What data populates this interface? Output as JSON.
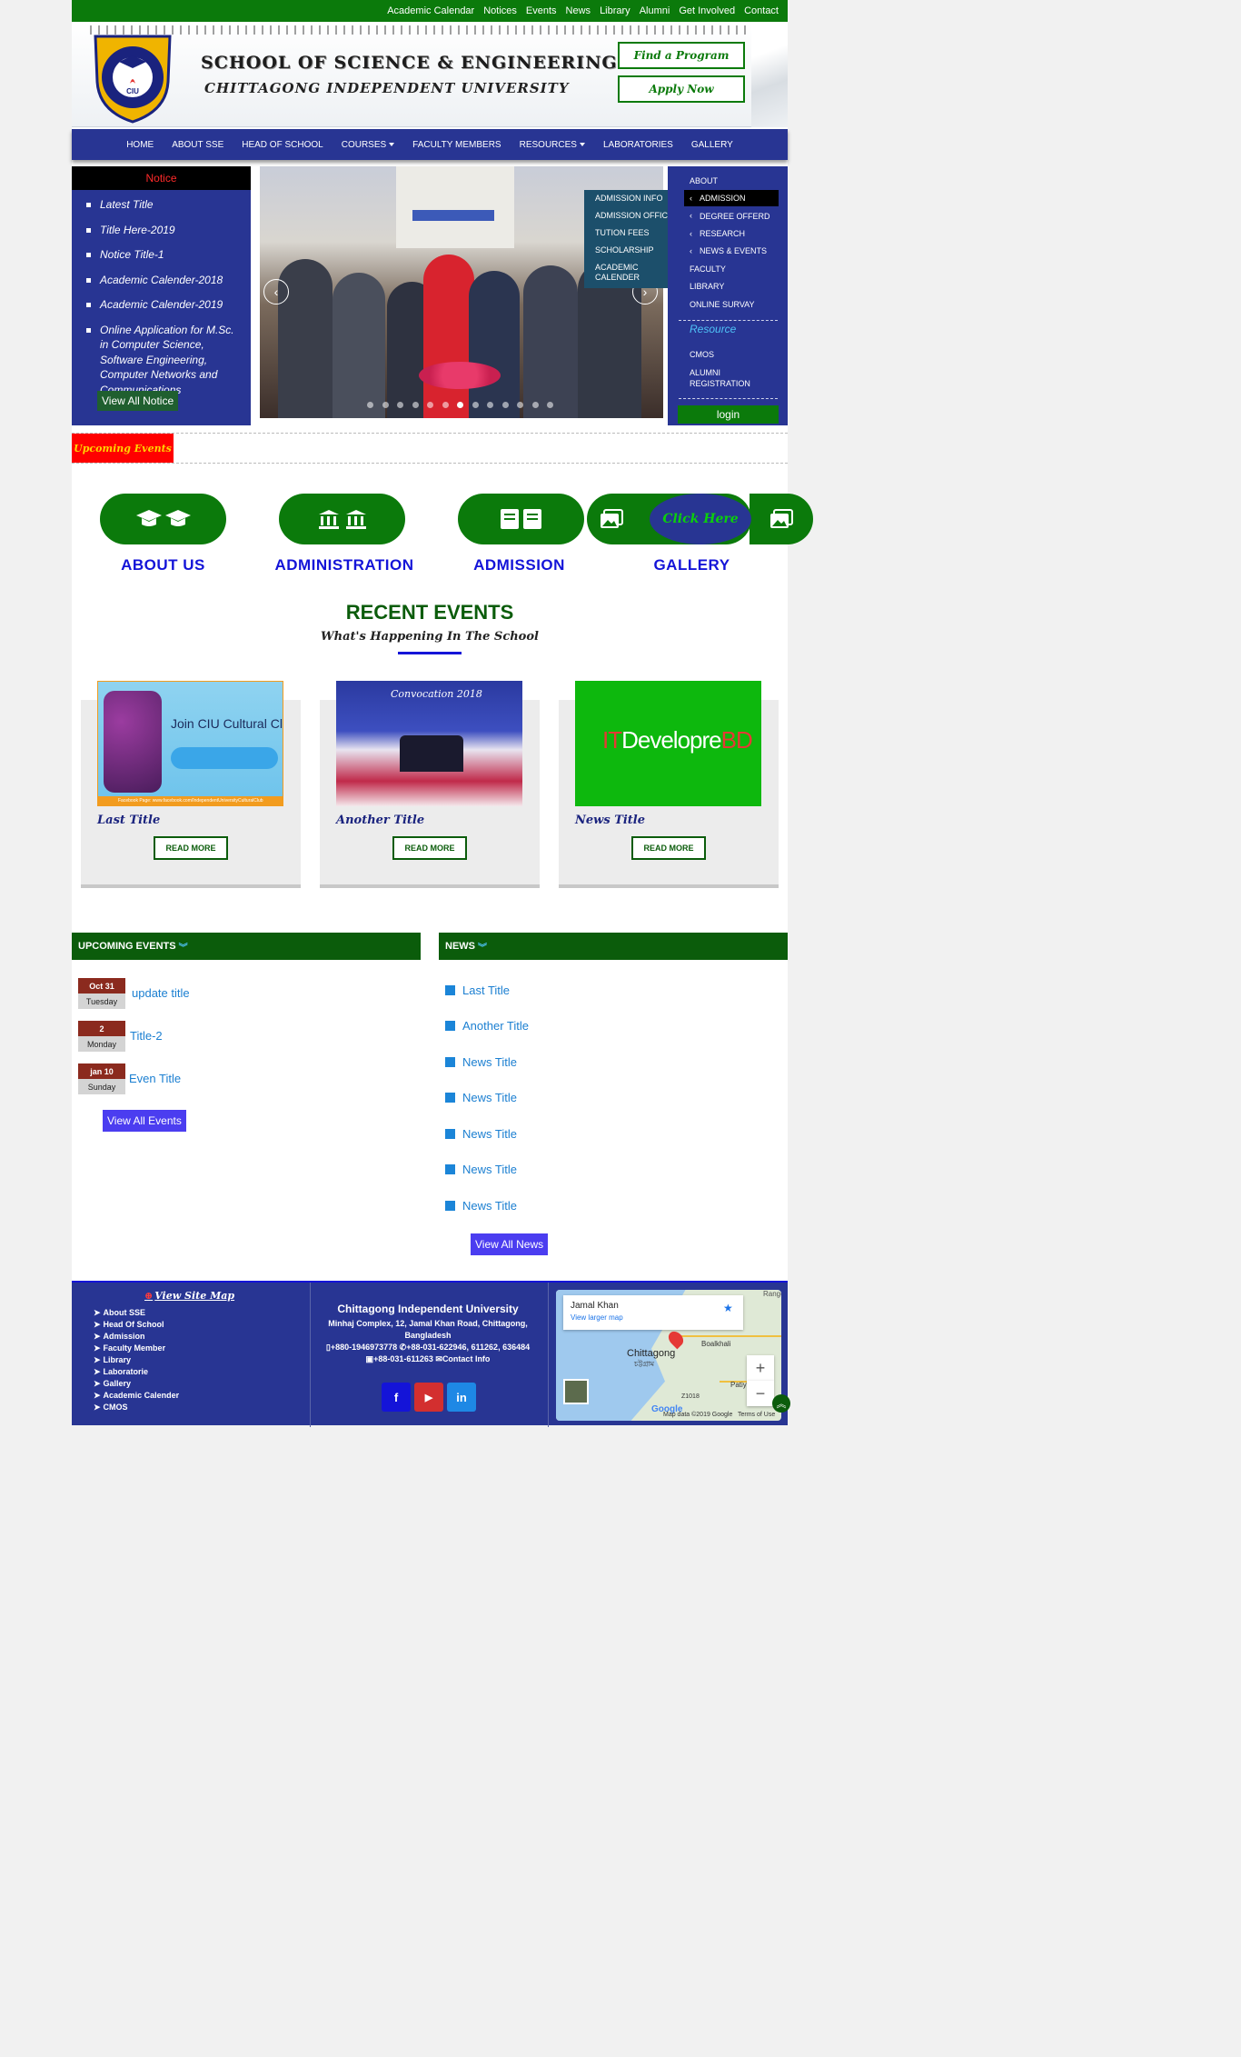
{
  "topbar": {
    "links": [
      "Academic Calendar",
      "Notices",
      "Events",
      "News",
      "Library",
      "Alumni",
      "Get Involved",
      "Contact"
    ]
  },
  "header": {
    "school_name": "SCHOOL OF SCIENCE & ENGINEERING",
    "university_name": "CHITTAGONG INDEPENDENT UNIVERSITY",
    "logo_text": "CIU",
    "find_program": "Find a Program",
    "apply_now": "Apply Now"
  },
  "nav": {
    "items": [
      "HOME",
      "ABOUT SSE",
      "HEAD OF SCHOOL",
      "COURSES",
      "FACULTY MEMBERS",
      "RESOURCES",
      "LABORATORIES",
      "GALLERY"
    ]
  },
  "notice": {
    "heading": "Notice",
    "items": [
      "Latest Title",
      "Title Here-2019",
      "Notice Title-1",
      "Academic Calender-2018",
      "Academic Calender-2019",
      "Online Application for M.Sc. in Computer Science, Software Engineering, Computer Networks and Communications"
    ],
    "view_all": "View All Notice"
  },
  "slider": {
    "prev": "‹",
    "next": "›",
    "slide_count": 13,
    "active_slide": 7,
    "dropdown": [
      "ADMISSION INFO",
      "ADMISSION OFFICE",
      "TUTION FEES",
      "SCHOLARSHIP",
      "ACADEMIC CALENDER"
    ]
  },
  "right_menu": {
    "items": [
      "ABOUT",
      "ADMISSION",
      "DEGREE OFFERD",
      "RESEARCH",
      "NEWS & EVENTS",
      "FACULTY",
      "LIBRARY",
      "ONLINE SURVAY"
    ],
    "resource_heading": "Resource",
    "resource_items": [
      "CMOS",
      "ALUMNI REGISTRATION"
    ],
    "login": "login"
  },
  "upcoming_label": "Upcoming Events",
  "quick_links": {
    "items": [
      {
        "label": "ABOUT US",
        "icon": "graduation-cap-icon"
      },
      {
        "label": "ADMINISTRATION",
        "icon": "institution-icon"
      },
      {
        "label": "ADMISSION",
        "icon": "book-icon"
      },
      {
        "label": "GALLERY",
        "icon": "image-icon"
      }
    ],
    "click_here": "Click Here"
  },
  "recent_events": {
    "title": "RECENT EVENTS",
    "subtitle": "What's Happening In The School",
    "cards": [
      {
        "title": "Last Title",
        "button": "READ MORE",
        "image_heading": "Join CIU Cultural Club",
        "image_caption": "Facebook Page: www.facebook.com/IndependentUniversityCulturalClub"
      },
      {
        "title": "Another Title",
        "button": "READ MORE",
        "image_heading": "Convocation 2018"
      },
      {
        "title": "News Title",
        "button": "READ MORE",
        "image_text_a": "IT",
        "image_text_b": "Developre",
        "image_text_c": "BD"
      }
    ]
  },
  "events": {
    "heading": "UPCOMING EVENTS",
    "items": [
      {
        "date": "Oct 31",
        "day": "Tuesday",
        "title": "update title"
      },
      {
        "date": "2",
        "day": "Monday",
        "title": "Title-2"
      },
      {
        "date": "jan 10",
        "day": "Sunday",
        "title": "Even Title"
      }
    ],
    "view_all": "View All Events"
  },
  "news": {
    "heading": "NEWS",
    "items": [
      "Last Title",
      "Another Title",
      "News Title",
      "News Title",
      "News Title",
      "News Title",
      "News Title"
    ],
    "view_all": "View All News"
  },
  "footer": {
    "sitemap_title": "View Site Map",
    "sitemap_items": [
      "About SSE",
      "Head Of School",
      "Admission",
      "Faculty Member",
      "Library",
      "Laboratorie",
      "Gallery",
      "Academic Calender",
      "CMOS"
    ],
    "org_name": "Chittagong Independent University",
    "address": "Minhaj Complex, 12, Jamal Khan Road, Chittagong, Bangladesh",
    "mobile": "+880-1946973778",
    "phone": "+88-031-622946, 611262, 636484",
    "fax": "+88-031-611263",
    "contact": "Contact Info",
    "social": [
      "f",
      "▶",
      "in"
    ],
    "map": {
      "place": "Jamal Khan",
      "link": "View larger map",
      "city": "Chittagong",
      "city_bn": "চট্টগ্রাম",
      "credit": "Map data ©2019 Google",
      "terms": "Terms of Use",
      "area1": "Boalkhali",
      "area2": "Patiya",
      "road": "Z1018",
      "brand": "Google",
      "range": "Range"
    }
  },
  "colors": {
    "brand_green": "#0b7a0b",
    "brand_blue": "#283593",
    "accent_red": "#ff0000"
  }
}
